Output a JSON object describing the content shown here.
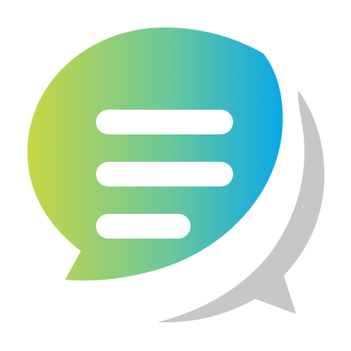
{
  "logo": {
    "icon": "chat-bubbles-icon",
    "colors": {
      "gradient_start": "#c8d645",
      "gradient_mid": "#6cc89a",
      "gradient_end": "#0aa8e8",
      "back_bubble": "#c6c7c9",
      "lines": "#ffffff",
      "background": "#ffffff"
    }
  }
}
